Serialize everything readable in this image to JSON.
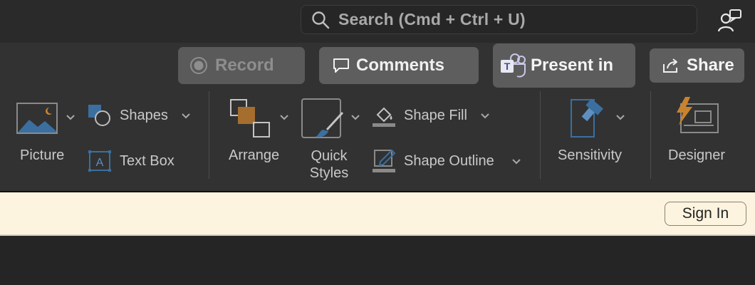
{
  "search": {
    "label": "Search (Cmd + Ctrl + U)"
  },
  "actions": {
    "record": "Record",
    "comments": "Comments",
    "present": "Present in",
    "share": "Share"
  },
  "ribbon": {
    "picture": "Picture",
    "shapes": "Shapes",
    "text_box": "Text Box",
    "arrange": "Arrange",
    "quick_styles": [
      "Quick",
      "Styles"
    ],
    "shape_fill": "Shape Fill",
    "shape_outline": "Shape Outline",
    "sensitivity": "Sensitivity",
    "designer": "Designer"
  },
  "message_bar": {
    "sign_in": "Sign In"
  },
  "colors": {
    "ribbon_bg": "#323232",
    "titlebar_bg": "#2a2a2a",
    "message_bar_bg": "#fdf4df",
    "accent_blue": "#3b6fa0",
    "accent_orange": "#c8832e"
  },
  "icons": [
    "search-icon",
    "feedback-icon",
    "record-icon",
    "comment-icon",
    "teams-icon",
    "share-icon",
    "picture-icon",
    "shapes-icon",
    "text-box-icon",
    "arrange-icon",
    "quick-styles-icon",
    "shape-fill-icon",
    "shape-outline-icon",
    "sensitivity-icon",
    "designer-icon",
    "chevron-down-icon"
  ]
}
